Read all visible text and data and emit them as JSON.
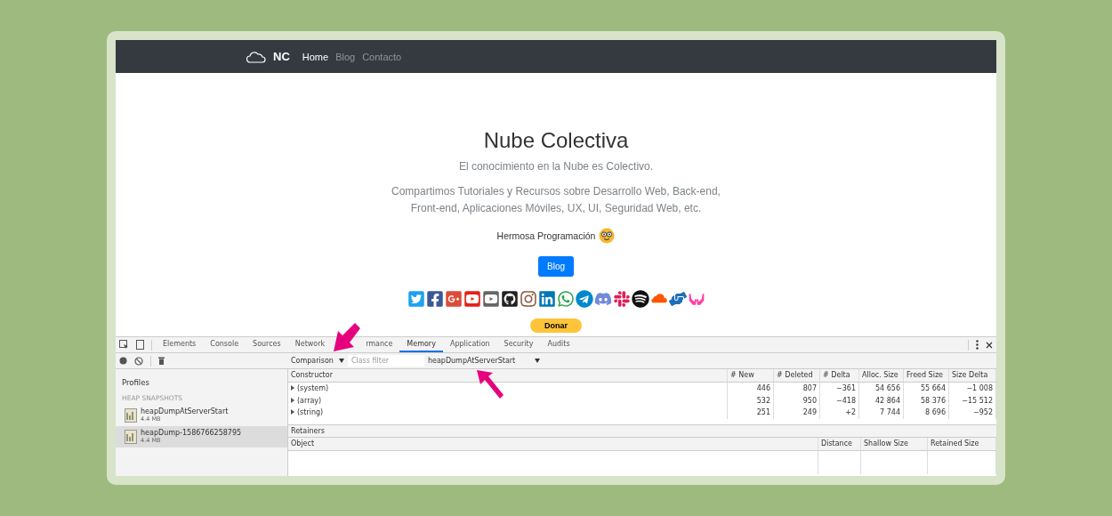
{
  "navbar": {
    "brand": "NC",
    "links": [
      {
        "label": "Home",
        "selected": true
      },
      {
        "label": "Blog",
        "selected": false
      },
      {
        "label": "Contacto",
        "selected": false
      }
    ]
  },
  "hero": {
    "title": "Nube Colectiva",
    "subtitle": "El conocimiento en la Nube es Colectivo.",
    "description_lines": [
      "Compartimos Tutoriales y Recursos sobre Desarrollo Web, Back-end,",
      "Front-end, Aplicaciones Móviles, UX, UI, Seguridad Web, etc."
    ],
    "greeting": "Hermosa Programación",
    "blog_button": "Blog",
    "donate_button": "Donar"
  },
  "devtools": {
    "tabs": [
      {
        "label": "Elements",
        "selected": false,
        "annotated": false
      },
      {
        "label": "Console",
        "selected": false,
        "annotated": false
      },
      {
        "label": "Sources",
        "selected": false,
        "annotated": false
      },
      {
        "label": "Network",
        "selected": false,
        "annotated": false
      },
      {
        "label": "rmance",
        "selected": false,
        "annotated": true
      },
      {
        "label": "Memory",
        "selected": true,
        "annotated": false
      },
      {
        "label": "Application",
        "selected": false,
        "annotated": false
      },
      {
        "label": "Security",
        "selected": false,
        "annotated": false
      },
      {
        "label": "Audits",
        "selected": false,
        "annotated": false
      }
    ],
    "view_select": "Comparison",
    "class_filter": {
      "placeholder": "Class filter"
    },
    "baseline_select": "heapDumpAtServerStart",
    "sidebar": {
      "heading": "Profiles",
      "section": "HEAP SNAPSHOTS",
      "snapshots": [
        {
          "name": "heapDumpAtServerStart",
          "size": "4.4 MB",
          "selected": false
        },
        {
          "name": "heapDump-1586766258795",
          "size": "4.4 MB",
          "selected": true
        }
      ]
    },
    "table": {
      "columns": [
        "Constructor",
        "# New",
        "# Deleted",
        "# Delta",
        "Alloc. Size",
        "Freed Size",
        "Size Delta"
      ],
      "rows": [
        {
          "cells": [
            "(system)",
            "446",
            "807",
            "−361",
            "54 656",
            "55 664",
            "−1 008"
          ]
        },
        {
          "cells": [
            "(array)",
            "532",
            "950",
            "−418",
            "42 864",
            "58 376",
            "−15 512"
          ]
        },
        {
          "cells": [
            "(string)",
            "251",
            "249",
            "+2",
            "7 744",
            "8 696",
            "−952"
          ]
        }
      ]
    },
    "retainers": {
      "title": "Retainers",
      "columns": [
        "Object",
        "Distance",
        "Shallow Size",
        "Retained Size"
      ]
    }
  }
}
